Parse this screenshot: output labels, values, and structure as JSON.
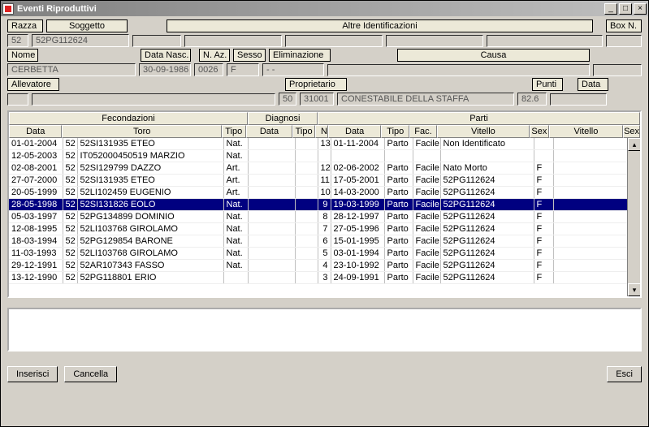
{
  "window": {
    "title": "Eventi Riproduttivi"
  },
  "titlebar_buttons": {
    "min": "_",
    "max": "□",
    "close": "×"
  },
  "labels": {
    "razza": "Razza",
    "soggetto": "Soggetto",
    "altre_id": "Altre Identificazioni",
    "box_n": "Box N.",
    "nome": "Nome",
    "data_nasc": "Data Nasc.",
    "n_az": "N. Az.",
    "sesso": "Sesso",
    "eliminazione": "Eliminazione",
    "causa": "Causa",
    "allevatore": "Allevatore",
    "proprietario": "Proprietario",
    "punti": "Punti",
    "data": "Data"
  },
  "values": {
    "razza": "52",
    "soggetto": "52PG112624",
    "box_n": "",
    "nome": "CERBETTA",
    "data_nasc": "30-09-1986",
    "n_az": "0026",
    "sesso": "F",
    "eliminazione": "- -",
    "causa": "",
    "allevatore_code": "",
    "allevatore_name": "",
    "proprietario_prefix": "50",
    "proprietario_code": "31001",
    "proprietario_name": "CONESTABILE DELLA STAFFA",
    "punti": "82.6",
    "data": ""
  },
  "grid": {
    "group_headers": {
      "fec": "Fecondazioni",
      "diag": "Diagnosi",
      "parti": "Parti"
    },
    "headers": {
      "f_data": "Data",
      "f_toro": "Toro",
      "f_tipo": "Tipo",
      "d_data": "Data",
      "d_tipo": "Tipo",
      "p_n": "N",
      "p_data": "Data",
      "p_tipo": "Tipo",
      "p_fac": "Fac.",
      "p_vit": "Vitello",
      "p_sex": "Sex",
      "p_vit2": "Vitello",
      "p_sex2": "Sex"
    },
    "rows": [
      {
        "f_data": "01-01-2004",
        "t": "52",
        "toro": "52SI131935   ETEO",
        "f_tipo": "Nat.",
        "d_data": "",
        "d_tipo": "",
        "n": "13",
        "p_data": "01-11-2004",
        "p_tipo": "Parto",
        "fac": "Facile",
        "vit": "Non Identificato",
        "sex": "",
        "vit2": "",
        "sex2": "",
        "sel": false
      },
      {
        "f_data": "12-05-2003",
        "t": "52",
        "toro": "IT052000450519 MARZIO",
        "f_tipo": "Nat.",
        "d_data": "",
        "d_tipo": "",
        "n": "",
        "p_data": "",
        "p_tipo": "",
        "fac": "",
        "vit": "",
        "sex": "",
        "vit2": "",
        "sex2": "",
        "sel": false
      },
      {
        "f_data": "02-08-2001",
        "t": "52",
        "toro": "52SI129799   DAZZO",
        "f_tipo": "Art.",
        "d_data": "",
        "d_tipo": "",
        "n": "12",
        "p_data": "02-06-2002",
        "p_tipo": "Parto",
        "fac": "Facile",
        "vit": "Nato Morto",
        "sex": "F",
        "vit2": "",
        "sex2": "",
        "sel": false
      },
      {
        "f_data": "27-07-2000",
        "t": "52",
        "toro": "52SI131935   ETEO",
        "f_tipo": "Art.",
        "d_data": "",
        "d_tipo": "",
        "n": "11",
        "p_data": "17-05-2001",
        "p_tipo": "Parto",
        "fac": "Facile",
        "vit": "52PG112624",
        "sex": "F",
        "vit2": "",
        "sex2": "",
        "sel": false
      },
      {
        "f_data": "20-05-1999",
        "t": "52",
        "toro": "52LI102459   EUGENIO",
        "f_tipo": "Art.",
        "d_data": "",
        "d_tipo": "",
        "n": "10",
        "p_data": "14-03-2000",
        "p_tipo": "Parto",
        "fac": "Facile",
        "vit": "52PG112624",
        "sex": "F",
        "vit2": "",
        "sex2": "",
        "sel": false
      },
      {
        "f_data": "28-05-1998",
        "t": "52",
        "toro": "52SI131826   EOLO",
        "f_tipo": "Nat.",
        "d_data": "",
        "d_tipo": "",
        "n": "9",
        "p_data": "19-03-1999",
        "p_tipo": "Parto",
        "fac": "Facile",
        "vit": "52PG112624",
        "sex": "F",
        "vit2": "",
        "sex2": "",
        "sel": true
      },
      {
        "f_data": "05-03-1997",
        "t": "52",
        "toro": "52PG134899   DOMINIO",
        "f_tipo": "Nat.",
        "d_data": "",
        "d_tipo": "",
        "n": "8",
        "p_data": "28-12-1997",
        "p_tipo": "Parto",
        "fac": "Facile",
        "vit": "52PG112624",
        "sex": "F",
        "vit2": "",
        "sex2": "",
        "sel": false
      },
      {
        "f_data": "12-08-1995",
        "t": "52",
        "toro": "52LI103768   GIROLAMO",
        "f_tipo": "Nat.",
        "d_data": "",
        "d_tipo": "",
        "n": "7",
        "p_data": "27-05-1996",
        "p_tipo": "Parto",
        "fac": "Facile",
        "vit": "52PG112624",
        "sex": "F",
        "vit2": "",
        "sex2": "",
        "sel": false
      },
      {
        "f_data": "18-03-1994",
        "t": "52",
        "toro": "52PG129854   BARONE",
        "f_tipo": "Nat.",
        "d_data": "",
        "d_tipo": "",
        "n": "6",
        "p_data": "15-01-1995",
        "p_tipo": "Parto",
        "fac": "Facile",
        "vit": "52PG112624",
        "sex": "F",
        "vit2": "",
        "sex2": "",
        "sel": false
      },
      {
        "f_data": "11-03-1993",
        "t": "52",
        "toro": "52LI103768   GIROLAMO",
        "f_tipo": "Nat.",
        "d_data": "",
        "d_tipo": "",
        "n": "5",
        "p_data": "03-01-1994",
        "p_tipo": "Parto",
        "fac": "Facile",
        "vit": "52PG112624",
        "sex": "F",
        "vit2": "",
        "sex2": "",
        "sel": false
      },
      {
        "f_data": "29-12-1991",
        "t": "52",
        "toro": "52AR107343   FASSO",
        "f_tipo": "Nat.",
        "d_data": "",
        "d_tipo": "",
        "n": "4",
        "p_data": "23-10-1992",
        "p_tipo": "Parto",
        "fac": "Facile",
        "vit": "52PG112624",
        "sex": "F",
        "vit2": "",
        "sex2": "",
        "sel": false
      },
      {
        "f_data": "13-12-1990",
        "t": "52",
        "toro": "52PG118801   ERIO",
        "f_tipo": "",
        "d_data": "",
        "d_tipo": "",
        "n": "3",
        "p_data": "24-09-1991",
        "p_tipo": "Parto",
        "fac": "Facile",
        "vit": "52PG112624",
        "sex": "F",
        "vit2": "",
        "sex2": "",
        "sel": false
      }
    ]
  },
  "buttons": {
    "inserisci": "Inserisci",
    "cancella": "Cancella",
    "esci": "Esci"
  }
}
